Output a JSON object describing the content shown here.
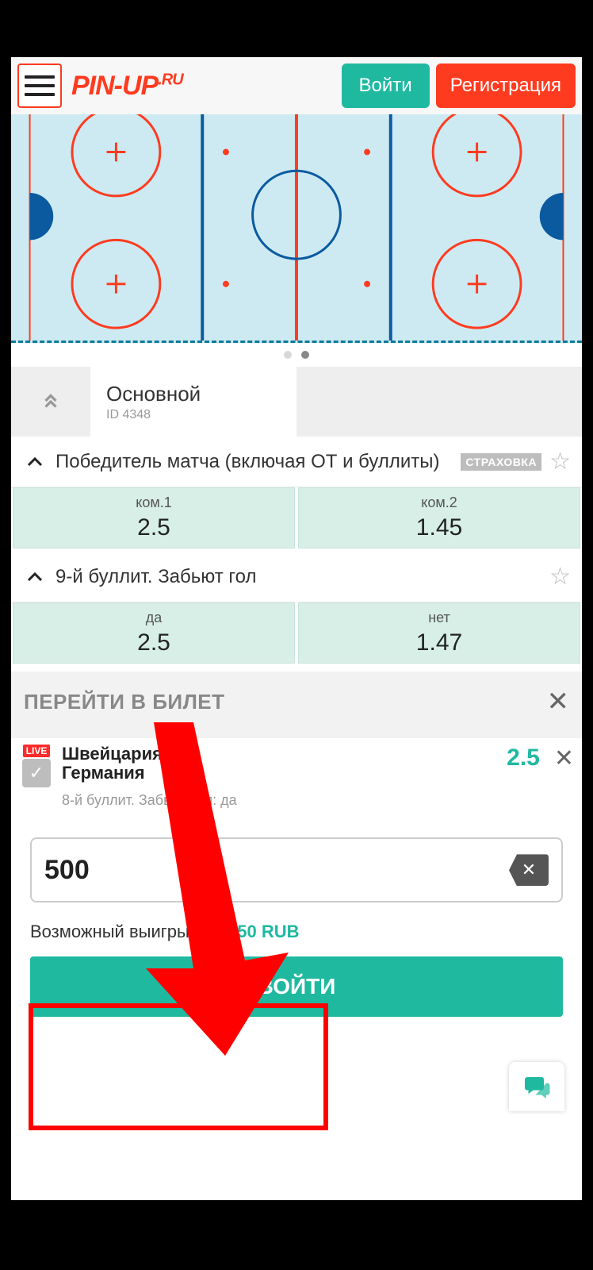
{
  "header": {
    "logo_main": "PIN-UP",
    "logo_suffix": ".RU",
    "login_label": "Войти",
    "register_label": "Регистрация"
  },
  "pager": {
    "count": 2,
    "active_index": 1
  },
  "tab": {
    "title": "Основной",
    "sub": "ID 4348"
  },
  "markets": [
    {
      "title": "Победитель матча (включая ОТ и буллиты)",
      "badge": "СТРАХОВКА",
      "options": [
        {
          "label": "ком.1",
          "value": "2.5"
        },
        {
          "label": "ком.2",
          "value": "1.45"
        }
      ]
    },
    {
      "title": "9-й буллит. Забьют гол",
      "badge": "",
      "options": [
        {
          "label": "да",
          "value": "2.5"
        },
        {
          "label": "нет",
          "value": "1.47"
        }
      ]
    }
  ],
  "slip": {
    "header_title": "ПЕРЕЙТИ В БИЛЕТ",
    "live_badge": "LIVE",
    "team1": "Швейцария",
    "team2": "Германия",
    "sub": "8-й буллит. Забьют гол: да",
    "odds": "2.5",
    "amount_value": "500",
    "possible_label": "Возможный выигрыш:",
    "possible_value": "1 250 RUB",
    "big_login": "ВОЙТИ"
  }
}
